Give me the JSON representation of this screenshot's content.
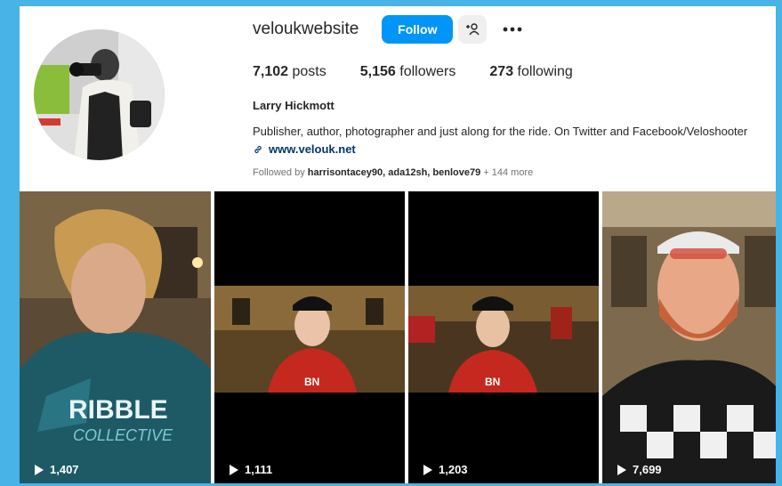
{
  "profile": {
    "username": "veloukwebsite",
    "follow_label": "Follow",
    "suggest_icon": "person-add-icon",
    "more_icon": "more-horizontal-icon",
    "stats": {
      "posts_count": "7,102",
      "posts_label": "posts",
      "followers_count": "5,156",
      "followers_label": "followers",
      "following_count": "273",
      "following_label": "following"
    },
    "full_name": "Larry Hickmott",
    "bio": "Publisher, author, photographer and just along for the ride. On Twitter and Facebook/Veloshooter",
    "website": "www.velouk.net",
    "followed_by_prefix": "Followed by",
    "followed_by_names": "harrisontacey90, ada12sh, benlove79",
    "followed_by_more": "+ 144 more"
  },
  "reels": [
    {
      "views": "1,407",
      "icon": "play-icon"
    },
    {
      "views": "1,111",
      "icon": "play-icon"
    },
    {
      "views": "1,203",
      "icon": "play-icon"
    },
    {
      "views": "7,699",
      "icon": "play-icon"
    }
  ],
  "colors": {
    "background": "#47b3e6",
    "follow_button": "#0095f6",
    "link": "#00376b"
  }
}
